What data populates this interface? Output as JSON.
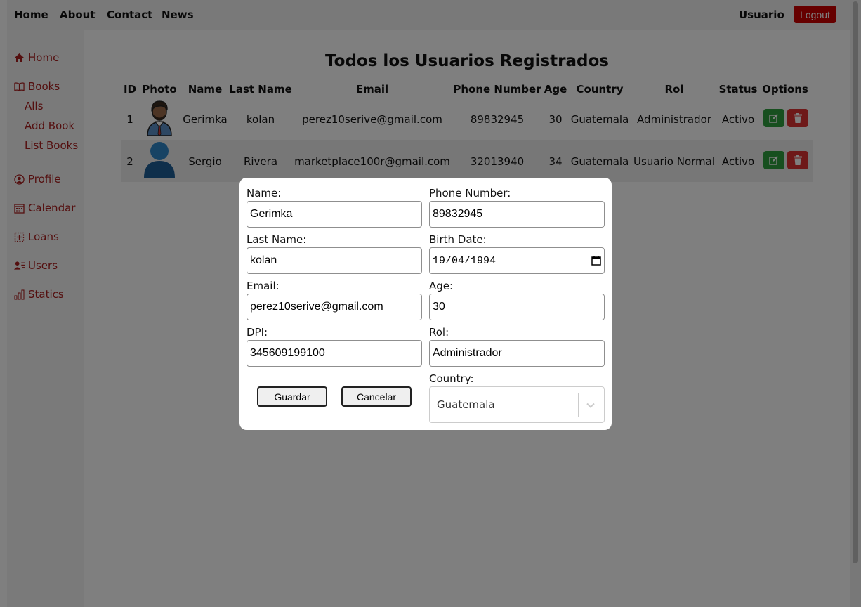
{
  "nav": {
    "home": "Home",
    "about": "About",
    "contact": "Contact",
    "news": "News",
    "user_label": "Usuario",
    "logout_label": "Logout"
  },
  "sidebar": {
    "items": [
      {
        "label": "Home",
        "icon": "home-icon"
      },
      {
        "label": "Books",
        "icon": "book-icon"
      },
      {
        "label": "Profile",
        "icon": "user-circle-icon"
      },
      {
        "label": "Calendar",
        "icon": "calendar-icon"
      },
      {
        "label": "Loans",
        "icon": "loans-icon"
      },
      {
        "label": "Users",
        "icon": "users-icon"
      },
      {
        "label": "Statics",
        "icon": "bar-chart-icon"
      }
    ],
    "book_subitems": [
      "Alls",
      "Add Book",
      "List Books"
    ]
  },
  "page": {
    "title": "Todos los Usuarios Registrados"
  },
  "table": {
    "columns": [
      "ID",
      "Photo",
      "Name",
      "Last Name",
      "Email",
      "Phone Number",
      "Age",
      "Country",
      "Rol",
      "Status",
      "Options"
    ],
    "rows": [
      {
        "id": "1",
        "name": "Gerimka",
        "last_name": "kolan",
        "email": "perez10serive@gmail.com",
        "phone": "89832945",
        "age": "30",
        "country": "Guatemala",
        "rol": "Administrador",
        "status": "Activo"
      },
      {
        "id": "2",
        "name": "Sergio",
        "last_name": "Rivera",
        "email": "marketplace100r@gmail.com",
        "phone": "32013940",
        "age": "34",
        "country": "Guatemala",
        "rol": "Usuario Normal",
        "status": "Activo"
      }
    ]
  },
  "modal": {
    "name_label": "Name:",
    "name_value": "Gerimka",
    "last_name_label": "Last Name:",
    "last_name_value": "kolan",
    "email_label": "Email:",
    "email_value": "perez10serive@gmail.com",
    "dpi_label": "DPI:",
    "dpi_value": "345609199100",
    "phone_label": "Phone Number:",
    "phone_value": "89832945",
    "birth_label": "Birth Date:",
    "birth_value": "19/04/1994",
    "age_label": "Age:",
    "age_value": "30",
    "rol_label": "Rol:",
    "rol_value": "Administrador",
    "country_label": "Country:",
    "country_value": "Guatemala",
    "save_label": "Guardar",
    "cancel_label": "Cancelar"
  },
  "colors": {
    "accent": "#a81e1e",
    "logout": "#cc0000",
    "edit": "#2e9e3e",
    "delete": "#dd3333"
  }
}
